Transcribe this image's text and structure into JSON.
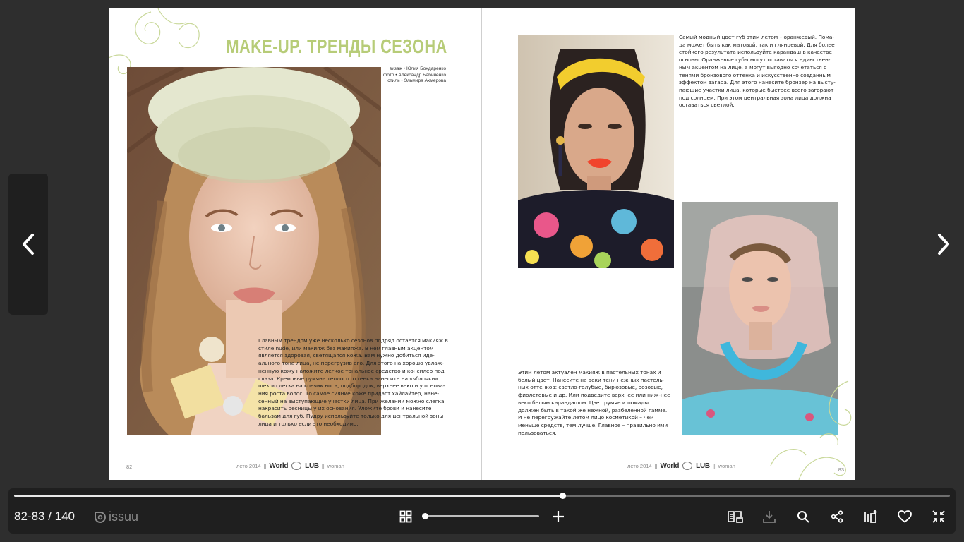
{
  "viewer": {
    "page_counter": "82-83 / 140",
    "brand": "issuu",
    "progress": 0.586,
    "zoom": 0.0
  },
  "toolbar_icons": [
    "grid-view-icon",
    "zoom-in-icon",
    "reader-mode-icon",
    "download-icon",
    "search-icon",
    "share-icon",
    "add-to-stack-icon",
    "like-icon",
    "exit-fullscreen-icon"
  ],
  "magazine": {
    "left": {
      "title": "MAKE-UP. ТРЕНДЫ СЕЗОНА",
      "credits": [
        "визаж • Юлия Бондаренко",
        "фото • Александр Бабиченко",
        "стиль • Эльмира Ахмерова"
      ],
      "body": "Главным трендом уже несколько сезонов подряд остается макияж в стиле nude, или макияж без макияжа. В нем главным акцентом является здоровая, светящаяся кожа. Вам нужно добиться иде-ального тона лица, не перегрузив его. Для этого на хорошо увлаж-ненную кожу наложите легкое тональное средство и консилер под глаза. Кремовые румяна теплого оттенка нанесите на «яблочки» щек и слегка на кончик носа, подбородок, верхнее веко и у основа-ния роста волос. То самое сияние коже придаст хайлайтер, нане-сенный на выступающие участки лица. При желании можно слегка накрасить ресницы у их основания. Уложите брови и нанесите бальзам для губ. Пудру используйте только для центральной зоны лица и только если это необходимо.",
      "page_number": "82",
      "footer_season": "лето 2014",
      "footer_brand_left": "World",
      "footer_brand_right": "LUB",
      "footer_section": "woman"
    },
    "right": {
      "body_top": "Самый модный цвет губ этим летом – оранжевый. Пома-да может быть как матовой, так и глянцевой. Для более стойкого результата используйте карандаш в качестве основы. Оранжевые губы могут оставаться единствен-ным акцентом на лице, а могут выгодно сочетаться с тенями бронзового оттенка и искусственно созданным эффектом загара. Для этого нанесите бронзер на высту-пающие участки лица, которые быстрее всего загорают под солнцем. При этом центральная зона лица должна оставаться светлой.",
      "body_bottom": "Этим летом актуален макияж в пастельных тонах и белый цвет. Нанесите на веки тени нежных пастель-ных оттенков: светло-голубые, бирюзовые, розовые, фиолетовые и др. Или подведите верхнее или ниж-нее веко белым карандашом. Цвет румян и помады должен быть в такой же нежной, разбеленной гамме. И не перегружайте летом лицо косметикой – чем меньше средств, тем лучше. Главное – правильно ими пользоваться.",
      "page_number": "83",
      "footer_season": "лето 2014",
      "footer_brand_left": "World",
      "footer_brand_right": "LUB",
      "footer_section": "woman"
    }
  },
  "colors": {
    "title_green": "#b7cc78",
    "viewer_bg": "#2e2e2e",
    "toolbar_bg": "#1f1f1f"
  }
}
